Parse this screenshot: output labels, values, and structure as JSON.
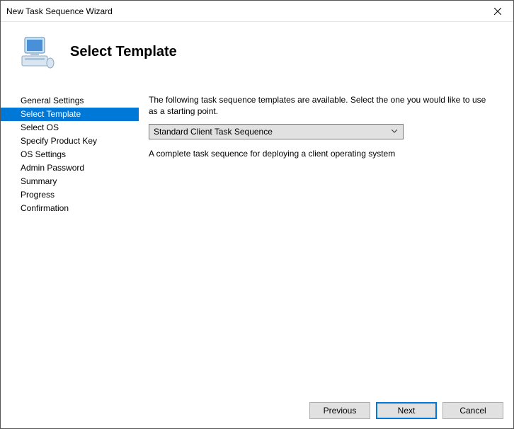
{
  "window": {
    "title": "New Task Sequence Wizard"
  },
  "header": {
    "title": "Select Template"
  },
  "sidebar": {
    "items": [
      {
        "label": "General Settings",
        "selected": false
      },
      {
        "label": "Select Template",
        "selected": true
      },
      {
        "label": "Select OS",
        "selected": false
      },
      {
        "label": "Specify Product Key",
        "selected": false
      },
      {
        "label": "OS Settings",
        "selected": false
      },
      {
        "label": "Admin Password",
        "selected": false
      },
      {
        "label": "Summary",
        "selected": false
      },
      {
        "label": "Progress",
        "selected": false
      },
      {
        "label": "Confirmation",
        "selected": false
      }
    ]
  },
  "main": {
    "intro": "The following task sequence templates are available.  Select the one you would like to use as a starting point.",
    "dropdown": {
      "selected": "Standard Client Task Sequence"
    },
    "description": "A complete task sequence for deploying a client operating system"
  },
  "footer": {
    "previous": "Previous",
    "next": "Next",
    "cancel": "Cancel"
  }
}
